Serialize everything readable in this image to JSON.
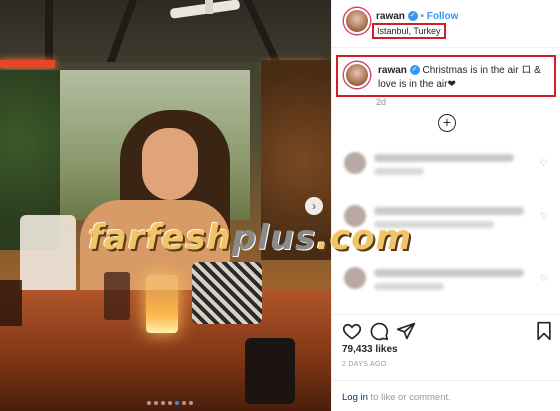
{
  "post": {
    "username": "rawan",
    "verified_glyph": "✓",
    "follow_separator": "•",
    "follow_label": "Follow",
    "location": "Istanbul, Turkey",
    "caption": "Christmas is in the air ロ & love is in the air❤",
    "time_ago": "2d",
    "likes": "79,433 likes",
    "posted": "2 DAYS AGO"
  },
  "photo": {
    "watermark_main": "farfesh",
    "watermark_plus": "plus",
    "watermark_tld": ".com",
    "next_arrow": "›",
    "carousel_dots": 7,
    "active_dot": 4
  },
  "comments": {
    "load_more_glyph": "+",
    "heart_glyph": "♡",
    "count_shown": 3,
    "blurred": true
  },
  "login": {
    "link_label": "Log in",
    "rest": " to like or comment."
  },
  "icons": {
    "like": "heart-icon",
    "comment": "comment-icon",
    "share": "share-icon",
    "save": "bookmark-icon"
  },
  "colors": {
    "link_blue": "#3897f0",
    "highlight_red": "#d11f2a",
    "text": "#262626",
    "muted": "#8e8e8e",
    "login_link": "#003569"
  }
}
